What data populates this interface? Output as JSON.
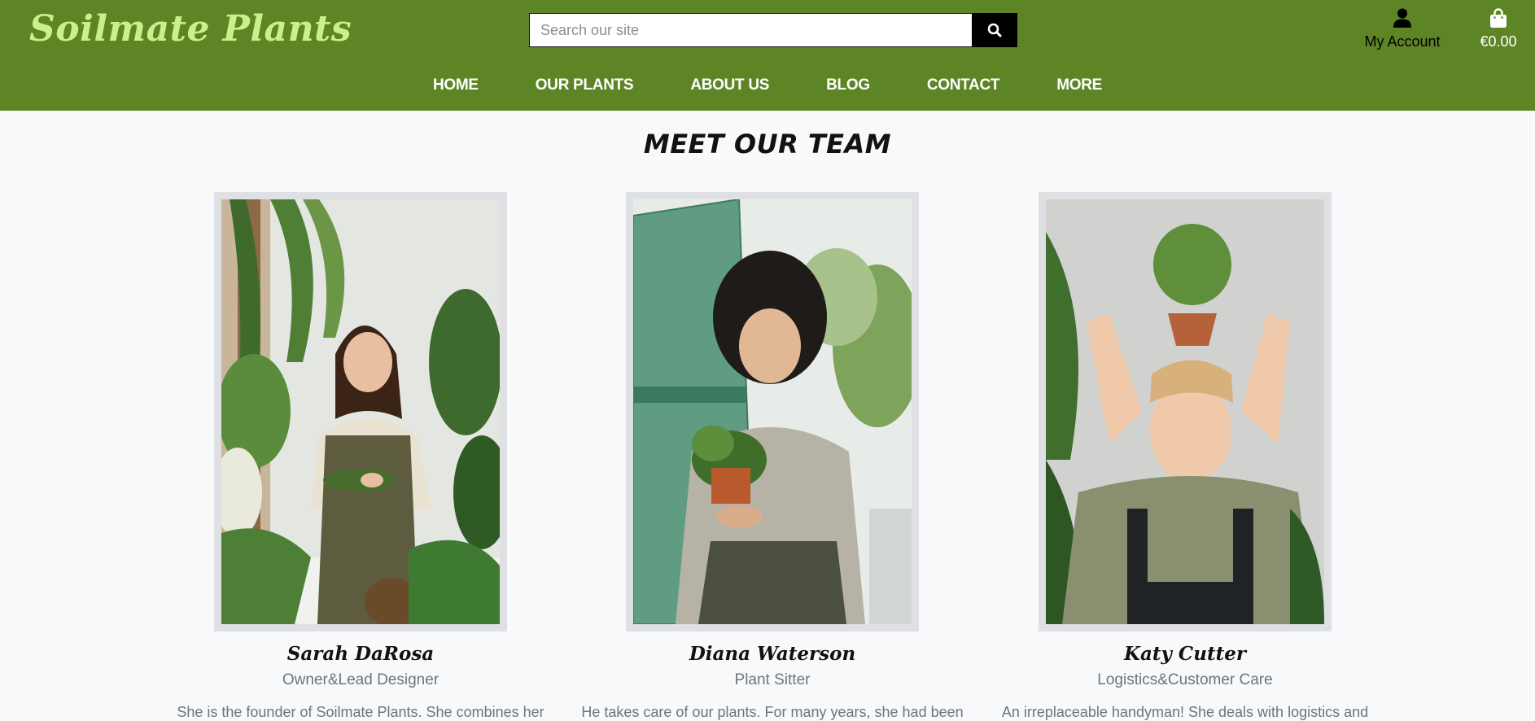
{
  "brand": {
    "name": "Soilmate Plants"
  },
  "search": {
    "placeholder": "Search our site",
    "icon": "search-icon"
  },
  "account": {
    "label": "My Account",
    "icon": "user-icon"
  },
  "cart": {
    "total": "€0.00",
    "icon": "shopping-bag-icon"
  },
  "nav": {
    "items": [
      {
        "label": "HOME"
      },
      {
        "label": "OUR PLANTS"
      },
      {
        "label": "ABOUT US"
      },
      {
        "label": "BLOG"
      },
      {
        "label": "CONTACT"
      },
      {
        "label": "MORE"
      }
    ]
  },
  "team": {
    "title": "MEET OUR TEAM",
    "members": [
      {
        "name": "Sarah DaRosa",
        "role": "Owner&Lead Designer",
        "bio": "She is the founder of Soilmate Plants. She combines her"
      },
      {
        "name": "Diana Waterson",
        "role": "Plant Sitter",
        "bio": "He takes care of our plants. For many years, she had been"
      },
      {
        "name": "Katy Cutter",
        "role": "Logistics&Customer Care",
        "bio": "An irreplaceable handyman! She deals with logistics and"
      }
    ]
  },
  "colors": {
    "header": "#5e8525",
    "logo": "#c8f08c",
    "background": "#f8f9fa"
  }
}
